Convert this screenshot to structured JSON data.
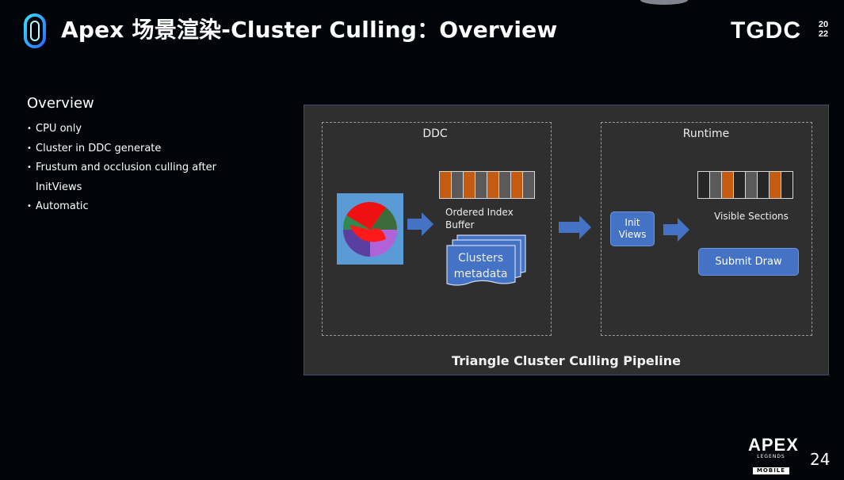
{
  "header": {
    "title": "Apex 场景渲染-Cluster Culling：Overview",
    "brand": "TGDC",
    "year_top": "20",
    "year_bottom": "22"
  },
  "overview": {
    "heading": "Overview",
    "bullets": [
      "CPU only",
      "Cluster in DDC generate",
      "Frustum and occlusion culling after InitViews",
      "Automatic"
    ]
  },
  "diagram": {
    "ddc_label": "DDC",
    "runtime_label": "Runtime",
    "ordered_index_label": "Ordered Index Buffer",
    "clusters_metadata_label": "Clusters metadata",
    "init_views_label": "Init Views",
    "visible_sections_label": "Visible Sections",
    "submit_draw_label": "Submit Draw",
    "caption": "Triangle Cluster Culling Pipeline",
    "index_buffer_cells": [
      "orange",
      "gray",
      "orange",
      "gray",
      "orange",
      "gray",
      "orange",
      "gray"
    ],
    "visible_sections_cells": [
      "dark",
      "gray",
      "orange",
      "dark",
      "gray",
      "dark",
      "orange",
      "dark"
    ],
    "colors": {
      "orange": "#c55a11",
      "gray": "#5a5a5a",
      "dark": "#262626",
      "arrow": "#4472c4",
      "button": "#4472c4"
    }
  },
  "footer": {
    "logo_main": "APEX",
    "logo_sub": "LEGENDS",
    "logo_mobile": "MOBILE",
    "page_number": "24"
  }
}
